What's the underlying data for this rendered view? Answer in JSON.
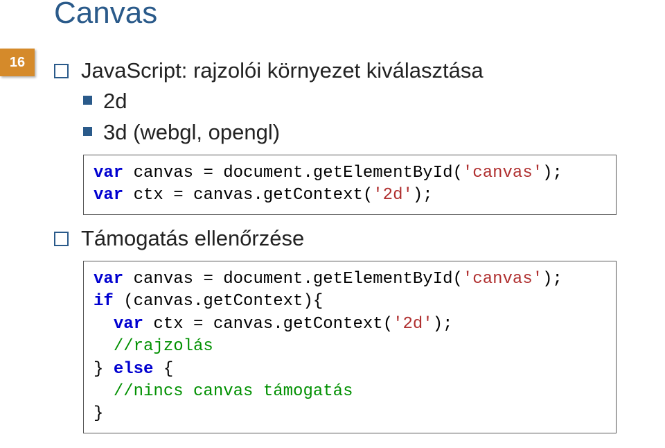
{
  "pageNumber": "16",
  "title": "Canvas",
  "bullets": {
    "main": "JavaScript: rajzolói környezet kiválasztása",
    "sub1": "2d",
    "sub2": "3d (webgl, opengl)",
    "support": "Támogatás ellenőrzése"
  },
  "code1": {
    "l1_kw1": "var",
    "l1_rest": " canvas = document.getElementById(",
    "l1_str": "'canvas'",
    "l1_end": ");",
    "l2_kw1": "var",
    "l2_rest": " ctx = canvas.getContext(",
    "l2_str": "'2d'",
    "l2_end": ");"
  },
  "code2": {
    "l1_kw1": "var",
    "l1_rest": " canvas = document.getElementById(",
    "l1_str": "'canvas'",
    "l1_end": ");",
    "l2_kw1": "if",
    "l2_rest": " (canvas.getContext){",
    "l3_kw1": "var",
    "l3_pre": "  ",
    "l3_rest": " ctx = canvas.getContext(",
    "l3_str": "'2d'",
    "l3_end": ");",
    "l4_pre": "  ",
    "l4_com": "//rajzolás",
    "l5_pre": "} ",
    "l5_kw1": "else",
    "l5_rest": " {",
    "l6_pre": "  ",
    "l6_com": "//nincs canvas támogatás",
    "l7": "}"
  }
}
